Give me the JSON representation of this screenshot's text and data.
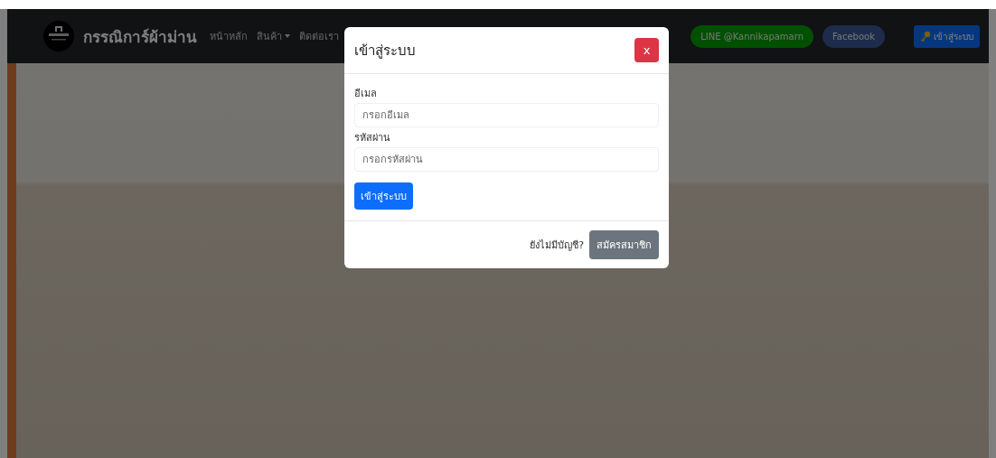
{
  "navbar": {
    "brand": "กรรณิการ์ผ้าม่าน",
    "links": [
      {
        "label": "หน้าหลัก",
        "dropdown": false
      },
      {
        "label": "สินค้า",
        "dropdown": true
      },
      {
        "label": "ติดต่อเรา",
        "dropdown": false
      }
    ],
    "pills": [
      {
        "label": "LINE @Kannikapamarn",
        "kind": "line"
      },
      {
        "label": "Facebook",
        "kind": "facebook"
      }
    ],
    "login_button": "เข้าสู่ระบบ"
  },
  "modal": {
    "title": "เข้าสู่ระบบ",
    "close": "x",
    "fields": [
      {
        "label": "อีเมล",
        "placeholder": "กรอกอีเมล"
      },
      {
        "label": "รหัสผ่าน",
        "placeholder": "กรอกรหัสผ่าน"
      }
    ],
    "submit": "เข้าสู่ระบบ",
    "footer_text": "ยังไม่มีบัญชี?",
    "register": "สมัครสมาชิก"
  }
}
